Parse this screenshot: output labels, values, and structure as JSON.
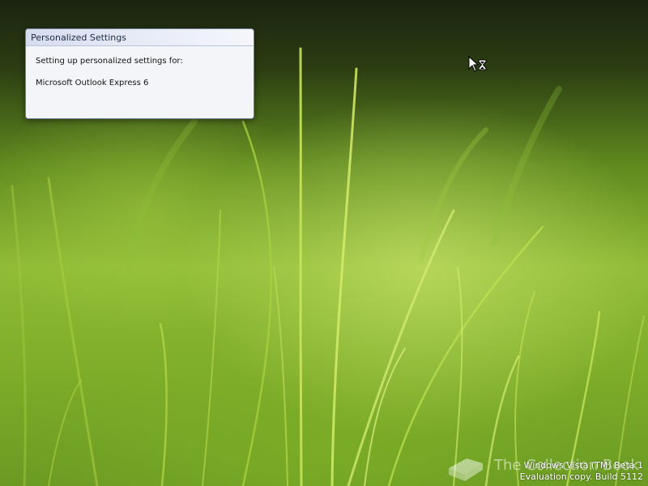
{
  "dialog": {
    "title": "Personalized Settings",
    "message": "Setting up personalized settings for:",
    "app_name": "Microsoft Outlook Express 6"
  },
  "cursor": {
    "icon": "busy-arrow-hourglass-icon"
  },
  "desktop_watermark": {
    "line1": "Windows Vista (TM) Beta 1",
    "line2": "Evaluation copy. Build 5112"
  },
  "site_watermark": {
    "text": "The Collection Book",
    "icon": "book-icon"
  },
  "colors": {
    "titlebar_start": "#d6dcf0",
    "dialog_bg": "#f3f4f7",
    "grass_green": "#8fbb35"
  }
}
